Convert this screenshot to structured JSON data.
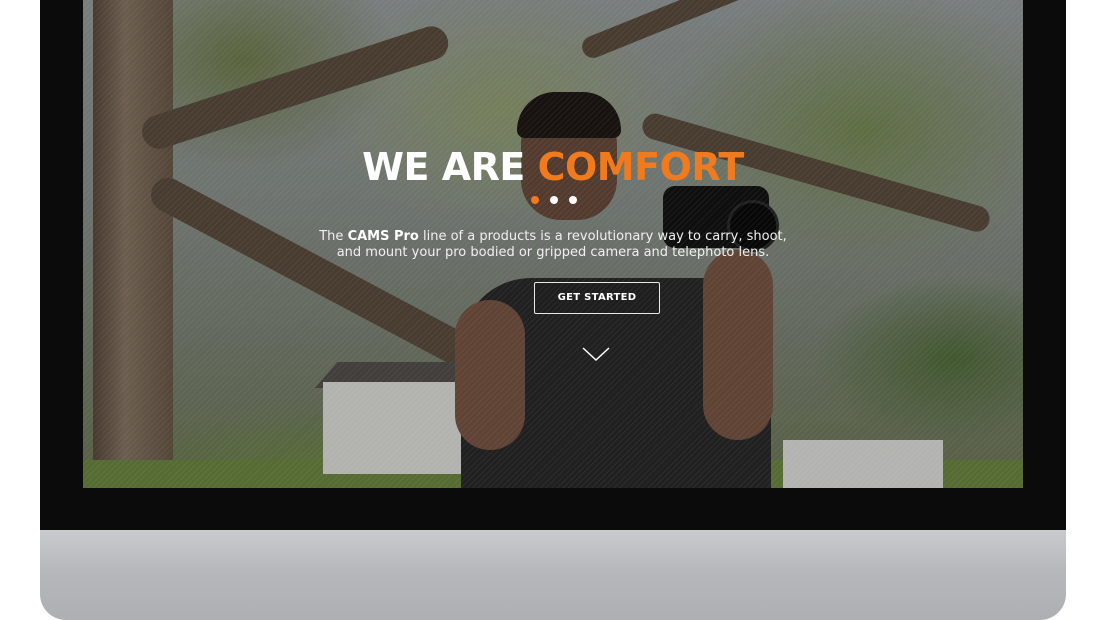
{
  "hero": {
    "headline_white": "WE ARE",
    "headline_accent": "COMFORT",
    "tagline_prefix": "The",
    "tagline_brand": "CAMS Pro",
    "tagline_line1_rest": "line of a products is a revolutionary way to carry, shoot,",
    "tagline_line2": "and mount your pro bodied or gripped camera and telephoto lens.",
    "cta_label": "GET STARTED",
    "scroll_icon": "chevron-down-icon",
    "carousel_dots": 3,
    "active_dot": 1
  },
  "colors": {
    "accent": "#f07b1e",
    "text": "#ffffff",
    "bezel": "#0b0b0b",
    "chin": "#b7b8bb"
  }
}
